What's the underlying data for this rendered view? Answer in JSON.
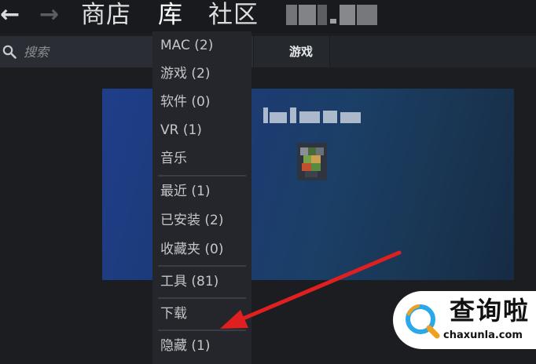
{
  "nav": {
    "back_icon": "arrow-left-icon",
    "forward_icon": "arrow-right-icon",
    "back_glyph": "←",
    "forward_glyph": "→",
    "tabs": [
      {
        "label": "商店"
      },
      {
        "label": "库"
      },
      {
        "label": "社区"
      }
    ],
    "profile_name_obscured": true
  },
  "search": {
    "placeholder": "搜索",
    "value": "",
    "icon": "search-icon"
  },
  "filter": {
    "label": "游戏"
  },
  "library_menu": {
    "items": [
      {
        "label": "MAC (2)"
      },
      {
        "label": "游戏 (2)"
      },
      {
        "label": "软件 (0)"
      },
      {
        "label": "VR (1)"
      },
      {
        "label": "音乐"
      },
      {
        "label": "最近 (1)"
      },
      {
        "label": "已安装 (2)"
      },
      {
        "label": "收藏夹 (0)"
      },
      {
        "label": "工具 (81)"
      },
      {
        "label": "下载"
      },
      {
        "label": "隐藏 (1)"
      }
    ]
  },
  "game_banner": {
    "title_obscured": true,
    "background_color": "#1c3a78"
  },
  "annotation": {
    "arrow_color": "#e02020",
    "points_to": "隐藏 (1)"
  },
  "watermark": {
    "text": "查询啦",
    "url": "chaxunla.com",
    "logo_color": "#2aa8e8",
    "logo_accent": "#f0a020"
  },
  "colors": {
    "app_bg": "#1b1d21",
    "menu_bg": "#24262b",
    "menu_text": "#c4c6c9",
    "active_tab": "#ffffff"
  }
}
